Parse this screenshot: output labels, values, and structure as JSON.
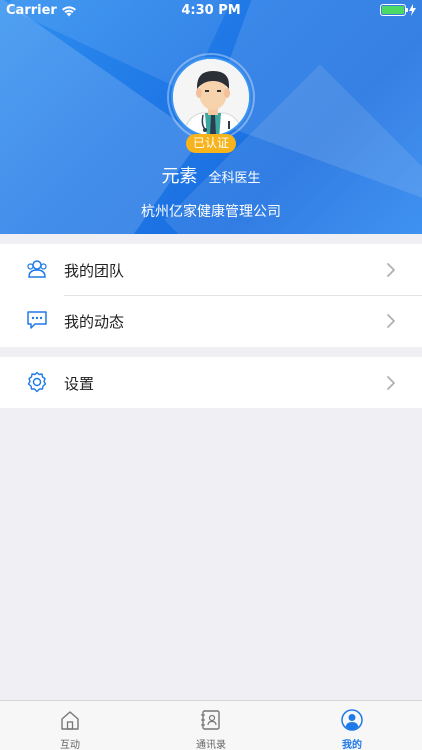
{
  "status_bar": {
    "carrier": "Carrier",
    "time": "4:30 PM"
  },
  "profile": {
    "verified_badge": "已认证",
    "name": "元素",
    "title": "全科医生",
    "organization": "杭州亿家健康管理公司"
  },
  "menu": {
    "group1": [
      {
        "label": "我的团队",
        "icon": "team-icon"
      },
      {
        "label": "我的动态",
        "icon": "message-icon"
      }
    ],
    "group2": [
      {
        "label": "设置",
        "icon": "gear-icon"
      }
    ]
  },
  "tabbar": {
    "tabs": [
      {
        "label": "互动",
        "icon": "home-icon"
      },
      {
        "label": "通讯录",
        "icon": "contacts-icon"
      },
      {
        "label": "我的",
        "icon": "profile-icon"
      }
    ],
    "active_index": 2
  },
  "colors": {
    "accent": "#1f7ae8",
    "badge": "#f6b31b"
  }
}
